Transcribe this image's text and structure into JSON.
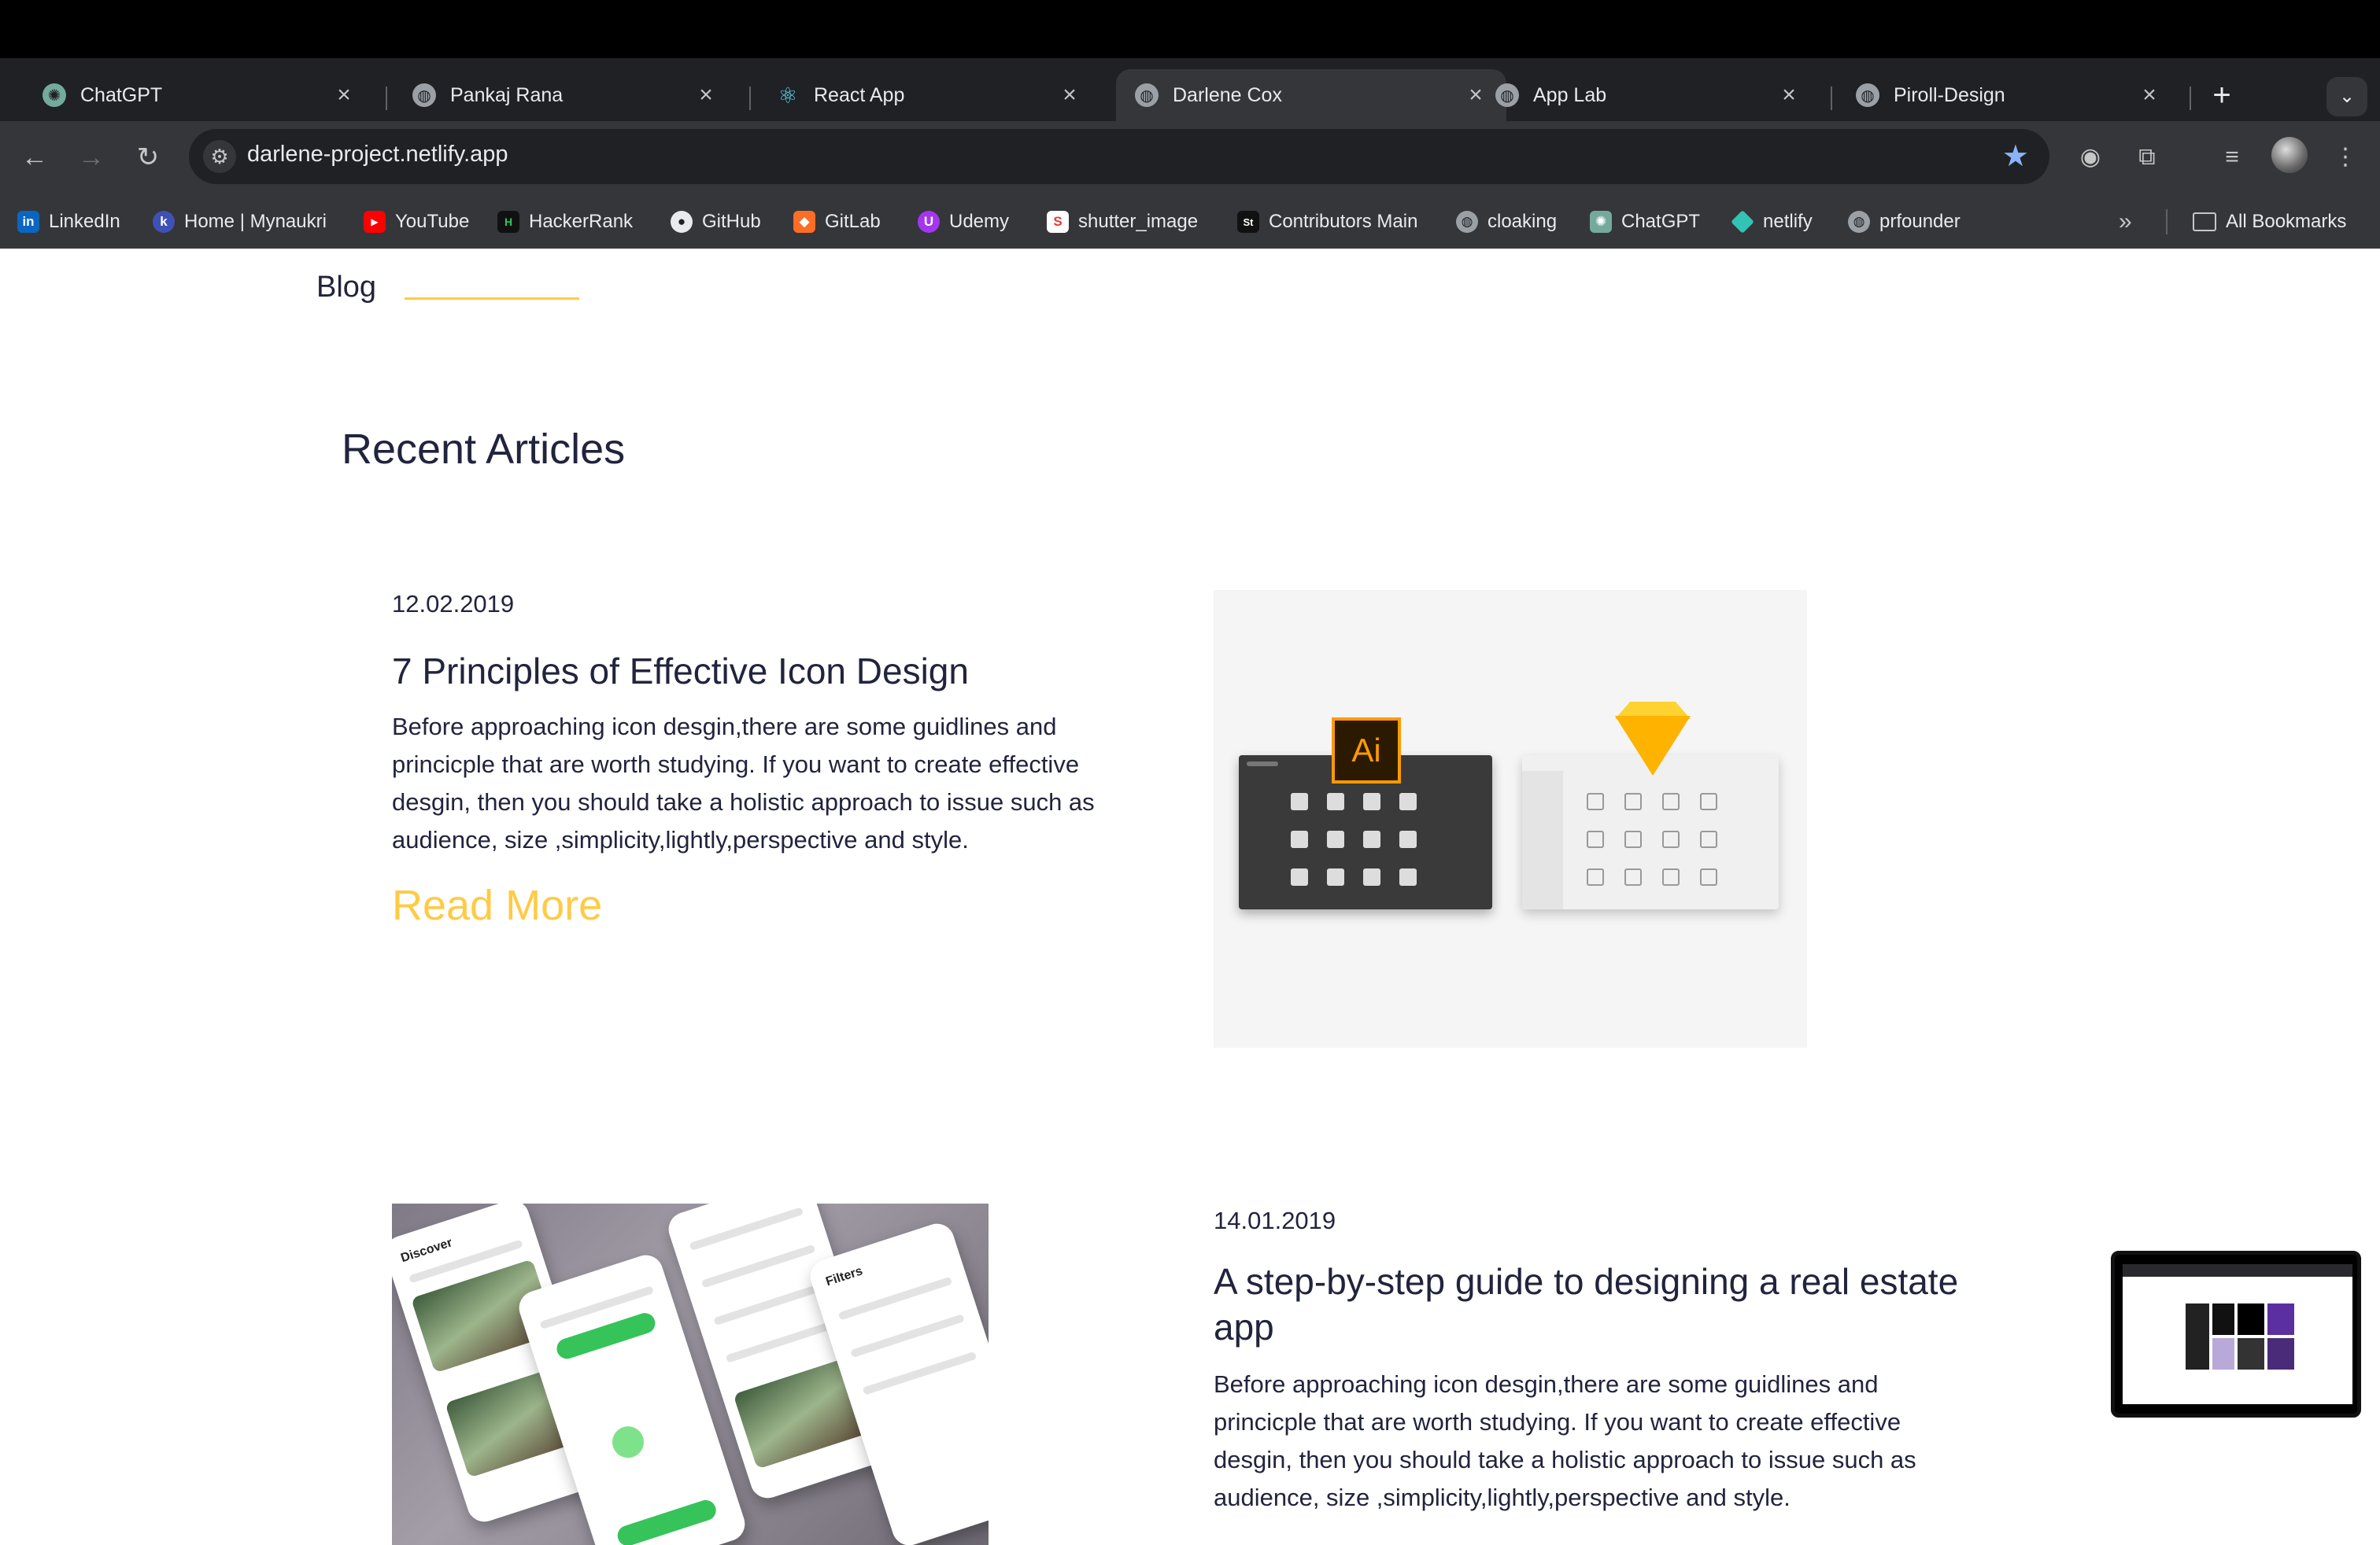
{
  "browser": {
    "tabs": [
      {
        "title": "ChatGPT",
        "icon": "chatgpt-icon",
        "active": false
      },
      {
        "title": "Pankaj Rana",
        "icon": "globe-icon",
        "active": false
      },
      {
        "title": "React App",
        "icon": "react-icon",
        "active": false
      },
      {
        "title": "Darlene Cox",
        "icon": "globe-icon",
        "active": true
      },
      {
        "title": "App Lab",
        "icon": "globe-icon",
        "active": false
      },
      {
        "title": "Piroll-Design",
        "icon": "globe-icon",
        "active": false
      }
    ],
    "url": "darlene-project.netlify.app",
    "bookmarks": [
      {
        "label": "LinkedIn",
        "icon": "linkedin-icon",
        "color": "#0a66c2"
      },
      {
        "label": "Home | Mynaukri",
        "icon": "mynaukri-icon",
        "color": "#3f51b5"
      },
      {
        "label": "YouTube",
        "icon": "youtube-icon",
        "color": "#ff0000"
      },
      {
        "label": "HackerRank",
        "icon": "hackerrank-icon",
        "color": "#111111"
      },
      {
        "label": "GitHub",
        "icon": "github-icon",
        "color": "#202124"
      },
      {
        "label": "GitLab",
        "icon": "gitlab-icon",
        "color": "#fc6d26"
      },
      {
        "label": "Udemy",
        "icon": "udemy-icon",
        "color": "#a435f0"
      },
      {
        "label": "shutter_image",
        "icon": "shutter-icon",
        "color": "#ffffff"
      },
      {
        "label": "Contributors Main",
        "icon": "contributors-icon",
        "color": "#111111"
      },
      {
        "label": "cloaking",
        "icon": "globe-icon",
        "color": "#9aa0a6"
      },
      {
        "label": "ChatGPT",
        "icon": "chatgpt-icon",
        "color": "#74aa9c"
      },
      {
        "label": "netlify",
        "icon": "netlify-icon",
        "color": "#32c3b5"
      },
      {
        "label": "prfounder",
        "icon": "globe-icon",
        "color": "#9aa0a6"
      }
    ],
    "all_bookmarks": "All Bookmarks"
  },
  "page": {
    "blog_label": "Blog",
    "section_title": "Recent Articles",
    "articles": [
      {
        "date": "12.02.2019",
        "title": "7 Principles of Effective Icon Design",
        "description": "Before approaching icon desgin,there are some guidlines and princicple that are worth studying. If you want to create effective desgin, then you should take a holistic approach to issue such as audience, size ,simplicity,lightly,perspective and style.",
        "read_more": "Read More"
      },
      {
        "date": "14.01.2019",
        "title": "A step-by-step guide to designing a real estate app",
        "description": "Before approaching icon desgin,there are some guidlines and princicple that are worth studying. If you want to create effective desgin, then you should take a holistic approach to issue such as audience, size ,simplicity,lightly,perspective and style."
      }
    ],
    "image1": {
      "ai_label": "Ai"
    },
    "accent_color": "#ffcb45",
    "text_color": "#21243d"
  }
}
